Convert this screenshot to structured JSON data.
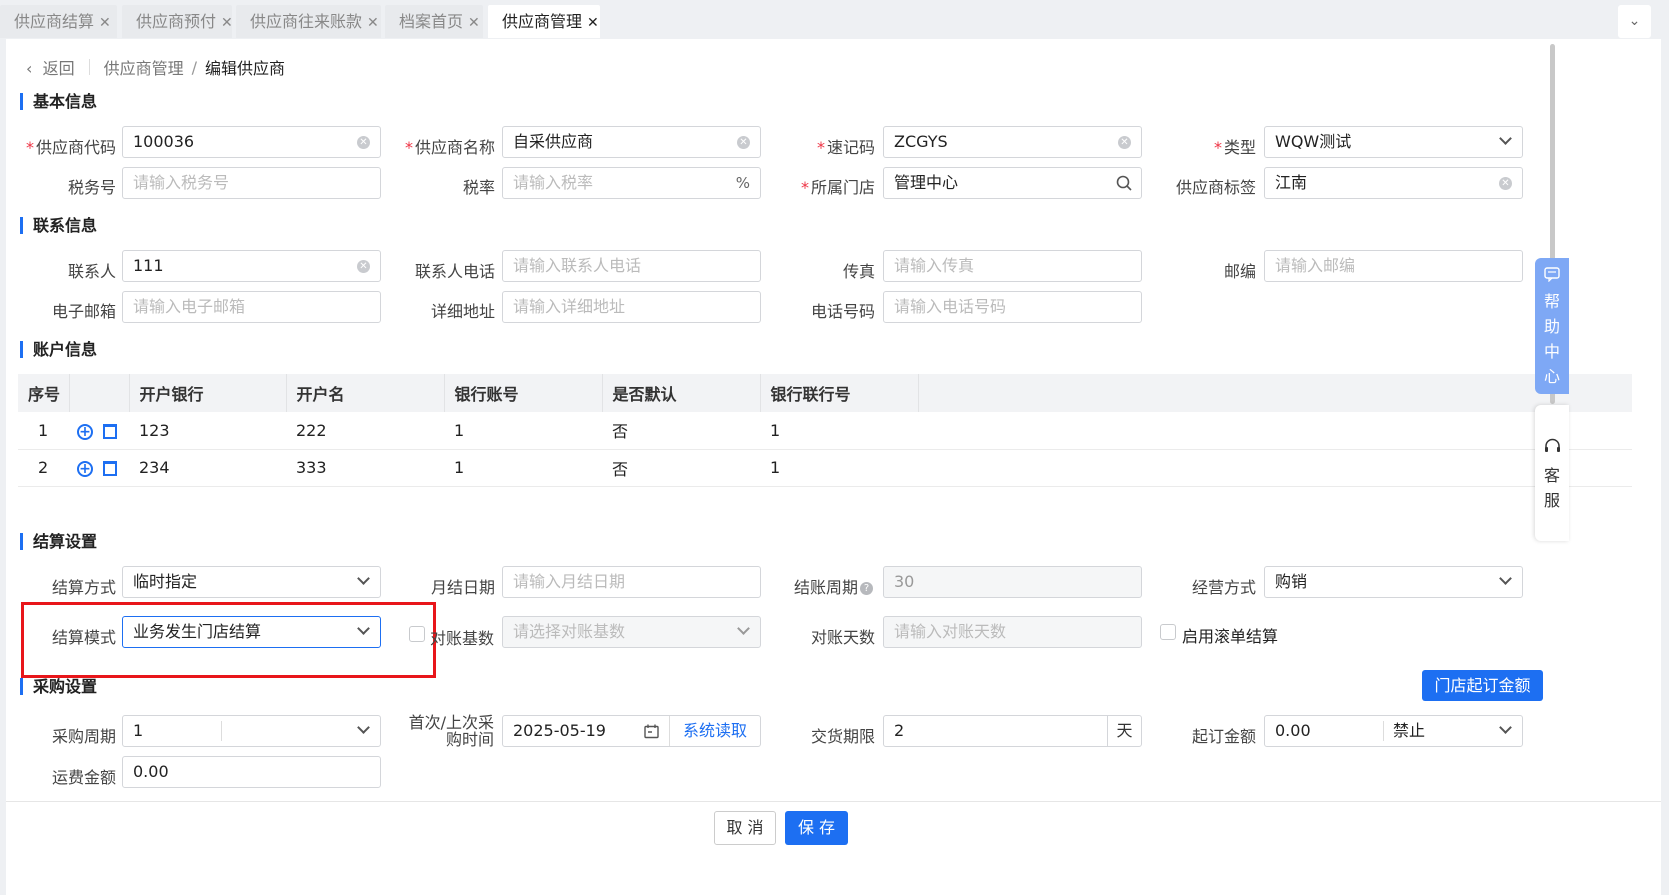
{
  "tabs": [
    {
      "label": "供应商结算",
      "active": false
    },
    {
      "label": "供应商预付",
      "active": false
    },
    {
      "label": "供应商往来账款",
      "active": false
    },
    {
      "label": "档案首页",
      "active": false
    },
    {
      "label": "供应商管理",
      "active": true
    }
  ],
  "breadcrumb": {
    "back": "返回",
    "parent": "供应商管理",
    "sep": "/",
    "current": "编辑供应商"
  },
  "sections": {
    "basic": "基本信息",
    "contact": "联系信息",
    "account": "账户信息",
    "settle": "结算设置",
    "purchase": "采购设置"
  },
  "basic": {
    "code_label": "供应商代码",
    "code_value": "100036",
    "name_label": "供应商名称",
    "name_value": "自采供应商",
    "mnemonic_label": "速记码",
    "mnemonic_value": "ZCGYS",
    "type_label": "类型",
    "type_value": "WQW测试",
    "tax_no_label": "税务号",
    "tax_no_placeholder": "请输入税务号",
    "tax_rate_label": "税率",
    "tax_rate_placeholder": "请输入税率",
    "tax_rate_suffix": "%",
    "store_label": "所属门店",
    "store_value": "管理中心",
    "tag_label": "供应商标签",
    "tag_value": "江南"
  },
  "contact": {
    "person_label": "联系人",
    "person_value": "111",
    "phone_label": "联系人电话",
    "phone_placeholder": "请输入联系人电话",
    "fax_label": "传真",
    "fax_placeholder": "请输入传真",
    "zip_label": "邮编",
    "zip_placeholder": "请输入邮编",
    "email_label": "电子邮箱",
    "email_placeholder": "请输入电子邮箱",
    "address_label": "详细地址",
    "address_placeholder": "请输入详细地址",
    "tel_label": "电话号码",
    "tel_placeholder": "请输入电话号码"
  },
  "account": {
    "headers": [
      "序号",
      "",
      "开户银行",
      "开户名",
      "银行账号",
      "是否默认",
      "银行联行号"
    ],
    "rows": [
      {
        "no": "1",
        "bank": "123",
        "name": "222",
        "acct": "1",
        "default": "否",
        "code": "1"
      },
      {
        "no": "2",
        "bank": "234",
        "name": "333",
        "acct": "1",
        "default": "否",
        "code": "1"
      }
    ]
  },
  "settle": {
    "method_label": "结算方式",
    "method_value": "临时指定",
    "month_day_label": "月结日期",
    "month_day_placeholder": "请输入月结日期",
    "period_label": "结账周期",
    "period_value": "30",
    "biz_label": "经营方式",
    "biz_value": "购销",
    "mode_label": "结算模式",
    "mode_value": "业务发生门店结算",
    "recon_base_label": "对账基数",
    "recon_base_placeholder": "请选择对账基数",
    "recon_days_label": "对账天数",
    "recon_days_placeholder": "请输入对账天数",
    "rolling_label": "启用滚单结算"
  },
  "purchase": {
    "store_min_btn": "门店起订金额",
    "cycle_label": "采购周期",
    "cycle_value": "1",
    "last_time_label_1": "首次/上次采",
    "last_time_label_2": "购时间",
    "last_time_value": "2025-05-19",
    "sys_read": "系统读取",
    "delivery_label": "交货期限",
    "delivery_value": "2",
    "delivery_unit": "天",
    "min_amount_label": "起订金额",
    "min_amount_value": "0.00",
    "min_amount_mode": "禁止",
    "freight_label": "运费金额",
    "freight_value": "0.00"
  },
  "footer": {
    "cancel": "取 消",
    "save": "保 存"
  },
  "side": {
    "help": [
      "帮",
      "助",
      "中",
      "心"
    ],
    "service": [
      "客",
      "服"
    ]
  },
  "colors": {
    "accent": "#1d6ff2",
    "highlight": "#e8161a"
  }
}
